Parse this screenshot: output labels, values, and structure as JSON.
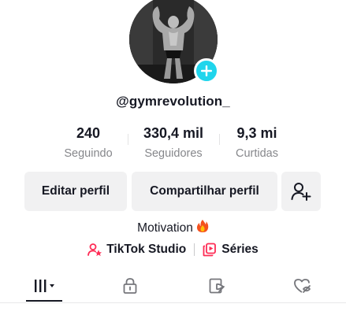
{
  "profile": {
    "username": "@gymrevolution_",
    "avatar_icon": "profile-photo",
    "add_icon": "plus-icon"
  },
  "stats": [
    {
      "value": "240",
      "label": "Seguindo"
    },
    {
      "value": "330,4 mil",
      "label": "Seguidores"
    },
    {
      "value": "9,3 mi",
      "label": "Curtidas"
    }
  ],
  "actions": {
    "edit_label": "Editar perfil",
    "share_label": "Compartilhar perfil",
    "add_friend_icon": "add-user-icon"
  },
  "bio": {
    "text": "Motivation",
    "emoji": "🔥"
  },
  "links": {
    "studio_label": "TikTok Studio",
    "series_label": "Séries"
  },
  "tabs": [
    {
      "icon": "grid-icon",
      "active": true
    },
    {
      "icon": "lock-icon",
      "active": false
    },
    {
      "icon": "repost-icon",
      "active": false
    },
    {
      "icon": "liked-hidden-icon",
      "active": false
    }
  ],
  "colors": {
    "accent": "#fe2c55",
    "badge": "#20d5ec",
    "text": "#161823",
    "muted": "#86878b",
    "button_bg": "#f1f1f2"
  }
}
